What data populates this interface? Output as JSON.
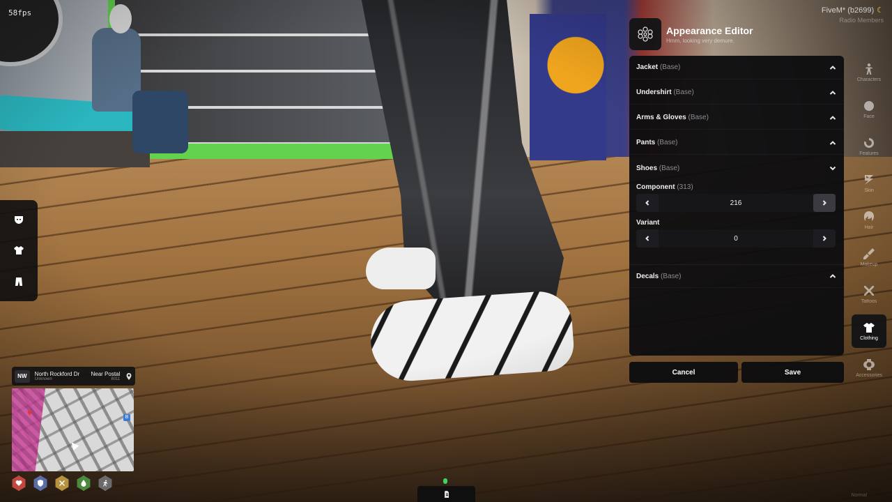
{
  "hud": {
    "fps": "58fps",
    "server": "FiveM* (b2699)",
    "server_sub": "Radio Members",
    "location": {
      "direction": "NW",
      "street": "North Rockford Dr",
      "area": "Unknown",
      "postal_label": "Near Postal",
      "postal_code": "8011"
    },
    "left_tools": [
      "mask-icon",
      "shirt-icon",
      "pants-icon"
    ],
    "status_icons": [
      {
        "name": "health-icon",
        "color": "#c2473f"
      },
      {
        "name": "armor-icon",
        "color": "#5b6ea8"
      },
      {
        "name": "hunger-icon",
        "color": "#b7933f"
      },
      {
        "name": "thirst-icon",
        "color": "#4a8a3e"
      },
      {
        "name": "stamina-icon",
        "color": "#6b6b6b"
      }
    ],
    "voice_icon": "microphone-icon"
  },
  "editor": {
    "title": "Appearance Editor",
    "subtitle": "Hmm, looking very demure.",
    "sections": {
      "jacket": {
        "label": "Jacket",
        "tag": "(Base)"
      },
      "undershirt": {
        "label": "Undershirt",
        "tag": "(Base)"
      },
      "arms": {
        "label": "Arms & Gloves",
        "tag": "(Base)"
      },
      "pants": {
        "label": "Pants",
        "tag": "(Base)"
      },
      "shoes": {
        "label": "Shoes",
        "tag": "(Base)"
      },
      "decals": {
        "label": "Decals",
        "tag": "(Base)"
      }
    },
    "component": {
      "label": "Component",
      "count": "(313)",
      "value": "216"
    },
    "variant": {
      "label": "Variant",
      "value": "0"
    },
    "cancel_label": "Cancel",
    "save_label": "Save"
  },
  "categories": [
    {
      "label": "Characters",
      "icon": "person-icon"
    },
    {
      "label": "Face",
      "icon": "face-icon"
    },
    {
      "label": "Features",
      "icon": "features-icon"
    },
    {
      "label": "Skin",
      "icon": "skin-icon"
    },
    {
      "label": "Hair",
      "icon": "hair-icon"
    },
    {
      "label": "Makeup",
      "icon": "makeup-icon"
    },
    {
      "label": "Tattoos",
      "icon": "tattoo-icon"
    },
    {
      "label": "Clothing",
      "icon": "shirt-icon",
      "active": true
    },
    {
      "label": "Accessories",
      "icon": "watch-icon"
    }
  ],
  "footer_faint": "Normal"
}
